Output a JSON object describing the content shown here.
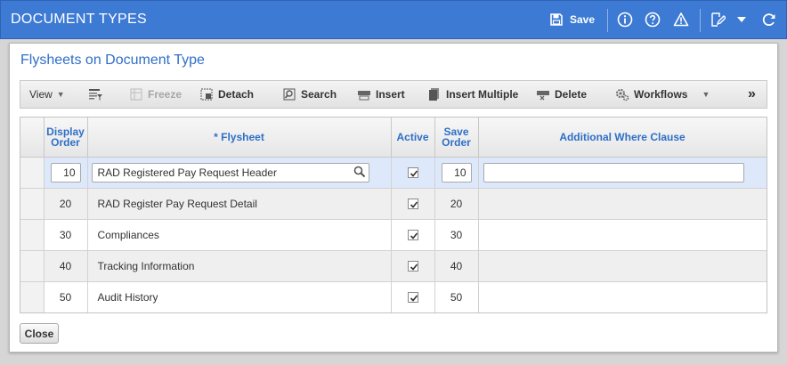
{
  "window": {
    "title": "DOCUMENT TYPES"
  },
  "titlebar": {
    "save_label": "Save",
    "icons": [
      "save-icon",
      "info-icon",
      "help-icon",
      "warning-icon",
      "edit-note-icon",
      "dropdown-caret-icon",
      "refresh-icon"
    ]
  },
  "panel": {
    "title": "Flysheets on Document Type"
  },
  "toolbar": {
    "view": "View",
    "freeze": "Freeze",
    "detach": "Detach",
    "search": "Search",
    "insert": "Insert",
    "insert_multiple": "Insert Multiple",
    "delete": "Delete",
    "workflows": "Workflows",
    "more": "»"
  },
  "grid": {
    "columns": {
      "display_order_1": "Display",
      "display_order_2": "Order",
      "flysheet": "* Flysheet",
      "active": "Active",
      "save_order_1": "Save",
      "save_order_2": "Order",
      "where": "Additional Where Clause"
    },
    "rows": [
      {
        "display_order": "10",
        "flysheet": "RAD Registered Pay Request Header",
        "active": true,
        "save_order": "10",
        "where": ""
      },
      {
        "display_order": "20",
        "flysheet": "RAD Register Pay Request Detail",
        "active": true,
        "save_order": "20",
        "where": ""
      },
      {
        "display_order": "30",
        "flysheet": "Compliances",
        "active": true,
        "save_order": "30",
        "where": ""
      },
      {
        "display_order": "40",
        "flysheet": "Tracking Information",
        "active": true,
        "save_order": "40",
        "where": ""
      },
      {
        "display_order": "50",
        "flysheet": "Audit History",
        "active": true,
        "save_order": "50",
        "where": ""
      }
    ]
  },
  "footer": {
    "close": "Close"
  },
  "colors": {
    "titlebar_bg": "#3d7ad4",
    "accent_text": "#2f6fc7",
    "selected_row": "#dde8fb"
  }
}
